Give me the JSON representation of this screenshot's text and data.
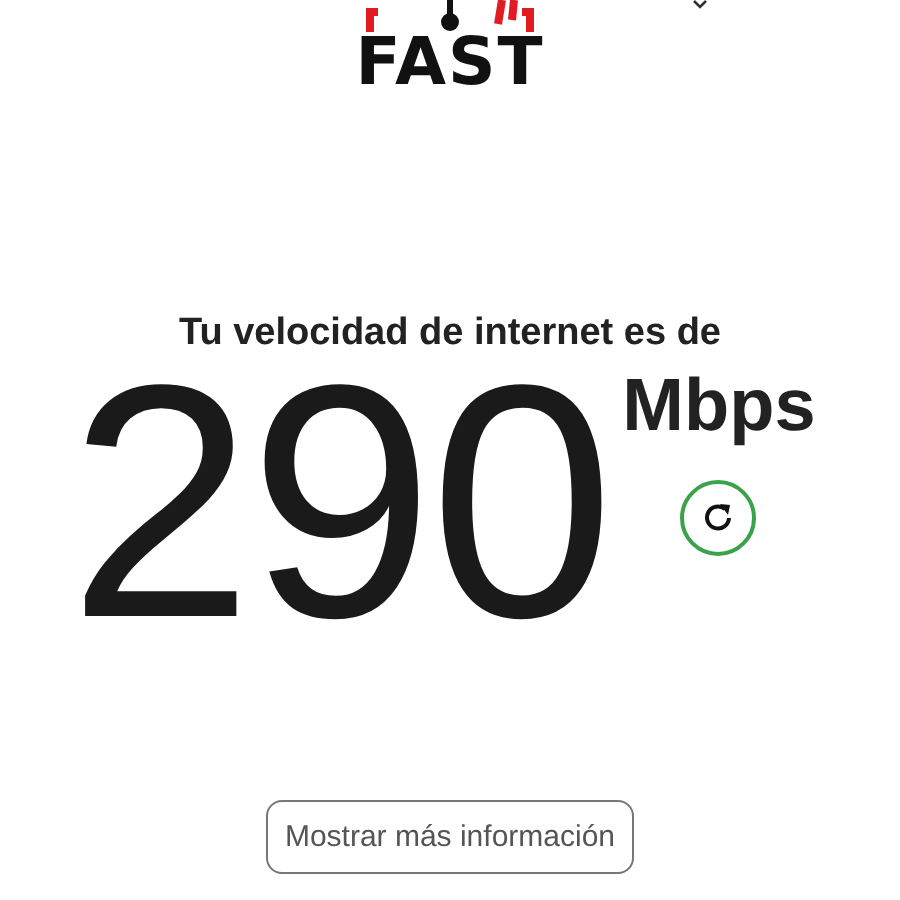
{
  "logo": {
    "text": "FAST"
  },
  "headline": "Tu velocidad de internet es de",
  "speed": {
    "value": "290",
    "unit": "Mbps"
  },
  "more_button": "Mostrar más información"
}
